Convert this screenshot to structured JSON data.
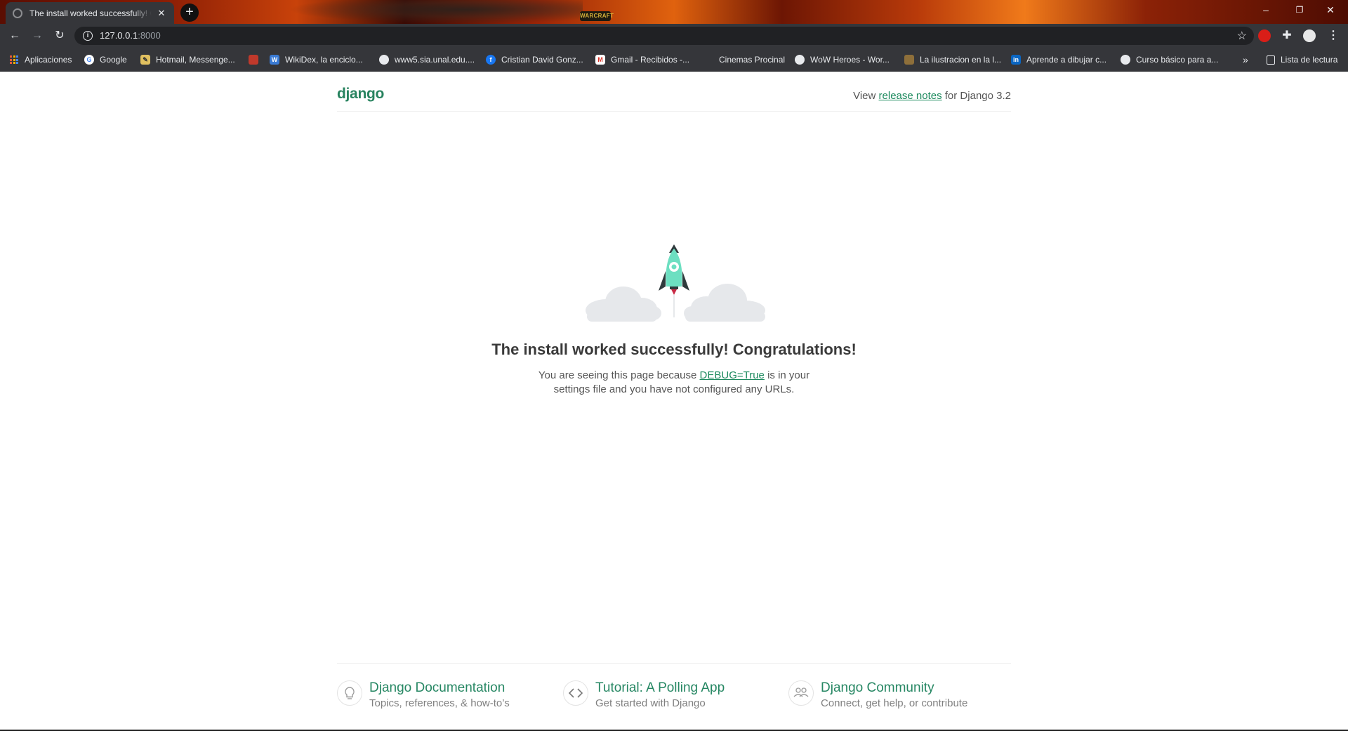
{
  "browser": {
    "tab_title": "The install worked successfully! Congratulations!",
    "url_host": "127.0.0.1",
    "url_port": ":8000",
    "titlebar_art_label": "WARCRAFT",
    "bookmarks": [
      {
        "label": "Aplicaciones",
        "icon": "apps-grid-icon"
      },
      {
        "label": "Google",
        "icon": "google-icon"
      },
      {
        "label": "Hotmail, Messenge...",
        "icon": "hotmail-icon"
      },
      {
        "label": "",
        "icon": "red-bookmark-icon"
      },
      {
        "label": "WikiDex, la enciclo...",
        "icon": "wikidex-icon"
      },
      {
        "label": "www5.sia.unal.edu....",
        "icon": "globe-icon"
      },
      {
        "label": "Cristian David Gonz...",
        "icon": "facebook-icon"
      },
      {
        "label": "Gmail - Recibidos -...",
        "icon": "gmail-icon"
      },
      {
        "label": "Cinemas Procinal",
        "icon": ""
      },
      {
        "label": "WoW Heroes - Wor...",
        "icon": "globe-icon"
      },
      {
        "label": "La ilustracion en la l...",
        "icon": "bookmark-icon"
      },
      {
        "label": "Aprende a dibujar c...",
        "icon": "linkedin-icon"
      },
      {
        "label": "Curso básico para a...",
        "icon": "globe-icon"
      }
    ],
    "more_bookmarks": "»",
    "reading_list": "Lista de lectura"
  },
  "django": {
    "logo": "django",
    "notes_prefix": "View ",
    "notes_link": "release notes",
    "notes_suffix": " for Django 3.2",
    "title": "The install worked successfully! Congratulations!",
    "sub_prefix": "You are seeing this page because ",
    "sub_link": "DEBUG=True",
    "sub_suffix": " is in your settings file and you have not configured any URLs.",
    "cards": [
      {
        "title": "Django Documentation",
        "desc": "Topics, references, & how-to’s",
        "icon": "lightbulb-icon"
      },
      {
        "title": "Tutorial: A Polling App",
        "desc": "Get started with Django",
        "icon": "code-icon"
      },
      {
        "title": "Django Community",
        "desc": "Connect, get help, or contribute",
        "icon": "people-icon"
      }
    ]
  },
  "colors": {
    "django_green": "#268763",
    "chrome_dark": "#35363a",
    "rocket_green": "#6ddfc1"
  }
}
